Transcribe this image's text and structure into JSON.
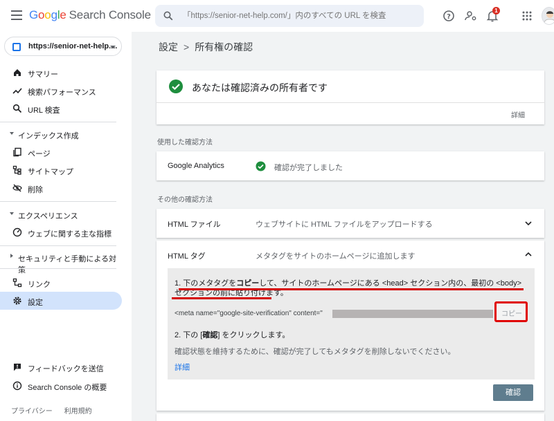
{
  "header": {
    "logo_letters": [
      "G",
      "o",
      "o",
      "g",
      "l",
      "e"
    ],
    "app_name": "Search Console",
    "search_placeholder": "「https://senior-net-help.com/」内のすべての URL を検査",
    "notifications_count": "1"
  },
  "sidebar": {
    "property": "https://senior-net-help....",
    "items": [
      {
        "label": "サマリー",
        "icon": "home-icon"
      },
      {
        "label": "検索パフォーマンス",
        "icon": "trending-icon"
      },
      {
        "label": "URL 検査",
        "icon": "search-icon"
      }
    ],
    "index_section": "インデックス作成",
    "index_items": [
      {
        "label": "ページ",
        "icon": "pages-icon"
      },
      {
        "label": "サイトマップ",
        "icon": "sitemap-icon"
      },
      {
        "label": "削除",
        "icon": "eye-off-icon"
      }
    ],
    "experience_section": "エクスペリエンス",
    "experience_items": [
      {
        "label": "ウェブに関する主な指標",
        "icon": "gauge-icon"
      }
    ],
    "security_section": "セキュリティと手動による対策",
    "bottom_items": [
      {
        "label": "リンク",
        "icon": "links-icon"
      },
      {
        "label": "設定",
        "icon": "settings-icon",
        "active": true
      }
    ],
    "footer_items": [
      {
        "label": "フィードバックを送信",
        "icon": "feedback-icon"
      },
      {
        "label": "Search Console の概要",
        "icon": "info-icon"
      }
    ],
    "footer_links": [
      "プライバシー",
      "利用規約"
    ]
  },
  "main": {
    "breadcrumb": [
      "設定",
      "所有権の確認"
    ],
    "owner_title": "あなたは確認済みの所有者です",
    "owner_details": "詳細",
    "used_method_label": "使用した確認方法",
    "ga": {
      "name": "Google Analytics",
      "status": "確認が完了しました"
    },
    "other_methods_label": "その他の確認方法",
    "html_file": {
      "name": "HTML ファイル",
      "desc": "ウェブサイトに HTML ファイルをアップロードする"
    },
    "html_tag": {
      "name": "HTML タグ",
      "desc": "メタタグをサイトのホームページに追加します",
      "step1_prefix": "1. 下のメタタグを",
      "step1_bold": "コピー",
      "step1_rest": "して、サイトのホームページにある <head> セクション内の、最初の <body> セクションの前に貼り付けます。",
      "meta_snippet": "<meta name=\"google-site-verification\" content=\"",
      "copy_label": "コピー",
      "step2_prefix": "2. 下の [",
      "step2_bold": "確認",
      "step2_suffix": "] をクリックします。",
      "keep_note": "確認状態を維持するために、確認が完了してもメタタグを削除しないでください。",
      "details_link": "詳細",
      "verify_label": "確認"
    }
  }
}
